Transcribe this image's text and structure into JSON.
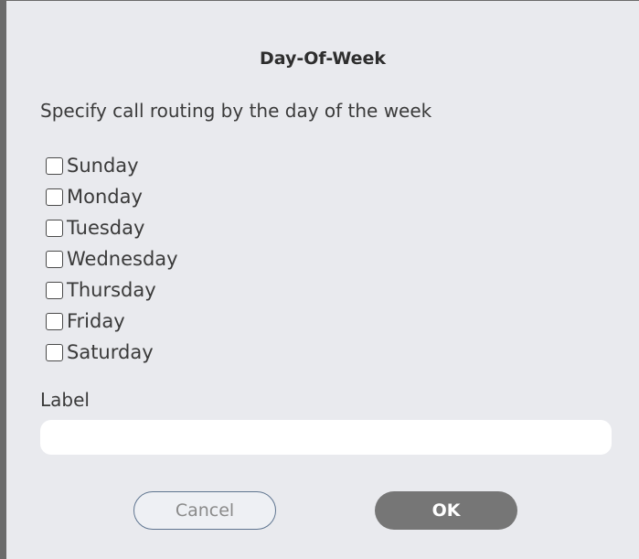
{
  "dialog": {
    "title": "Day-Of-Week",
    "description": "Specify call routing by the day of the week",
    "days": [
      {
        "label": "Sunday",
        "checked": false
      },
      {
        "label": "Monday",
        "checked": false
      },
      {
        "label": "Tuesday",
        "checked": false
      },
      {
        "label": "Wednesday",
        "checked": false
      },
      {
        "label": "Thursday",
        "checked": false
      },
      {
        "label": "Friday",
        "checked": false
      },
      {
        "label": "Saturday",
        "checked": false
      }
    ],
    "label_field": {
      "label": "Label",
      "value": "",
      "placeholder": ""
    },
    "buttons": {
      "cancel": "Cancel",
      "ok": "OK"
    }
  },
  "colors": {
    "background": "#e9eaee",
    "ok_button": "#767676",
    "cancel_border": "#5f7590"
  }
}
